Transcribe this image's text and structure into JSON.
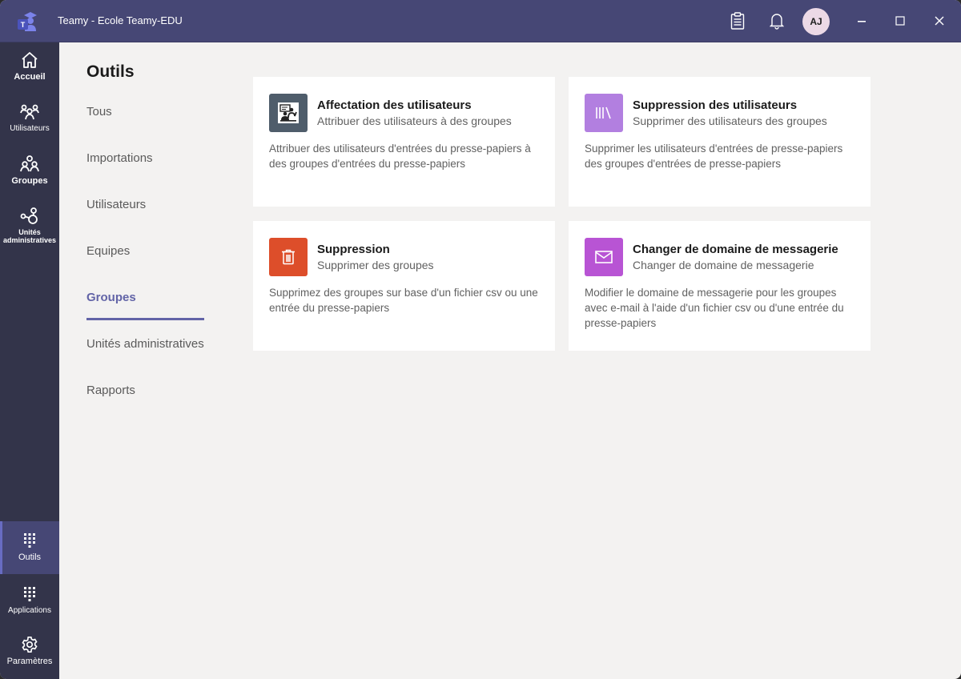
{
  "window": {
    "title": "Teamy - Ecole Teamy-EDU",
    "avatar_initials": "AJ",
    "icons": [
      "app-logo-icon",
      "clipboard-icon",
      "bell-icon",
      "minimize-icon",
      "maximize-icon",
      "close-icon"
    ]
  },
  "rail": {
    "items": [
      {
        "label": "Accueil",
        "icon": "home-icon"
      },
      {
        "label": "Utilisateurs",
        "icon": "users-icon"
      },
      {
        "label": "Groupes",
        "icon": "groups-icon"
      },
      {
        "label": "Unités administratives",
        "icon": "admin-units-icon"
      },
      {
        "label": "Outils",
        "icon": "grid-icon",
        "active": true
      },
      {
        "label": "Applications",
        "icon": "grid-icon"
      },
      {
        "label": "Paramètres",
        "icon": "gear-icon"
      }
    ]
  },
  "nav": {
    "title": "Outils",
    "items": [
      {
        "label": "Tous"
      },
      {
        "label": "Importations"
      },
      {
        "label": "Utilisateurs"
      },
      {
        "label": "Equipes"
      },
      {
        "label": "Groupes",
        "active": true
      },
      {
        "label": "Unités administratives"
      },
      {
        "label": "Rapports"
      }
    ]
  },
  "cards": [
    {
      "title": "Affectation des utilisateurs",
      "subtitle": "Attribuer des utilisateurs à des groupes",
      "description": "Attribuer des utilisateurs d'entrées du presse-papiers à des groupes d'entrées du presse-papiers",
      "icon": "assign-users-icon",
      "color": "#4f5d6b"
    },
    {
      "title": "Suppression des utilisateurs",
      "subtitle": "Supprimer des utilisateurs des groupes",
      "description": "Supprimer les utilisateurs d'entrées de presse-papiers des groupes d'entrées de presse-papiers",
      "icon": "library-icon",
      "color": "#b27fe0"
    },
    {
      "title": "Suppression",
      "subtitle": "Supprimer des groupes",
      "description": "Supprimez des groupes sur base d'un fichier csv ou une entrée du presse-papiers",
      "icon": "trash-icon",
      "color": "#dd4e2a"
    },
    {
      "title": "Changer de domaine de messagerie",
      "subtitle": "Changer de domaine de messagerie",
      "description": "Modifier le domaine de messagerie pour les groupes avec e-mail à l'aide d'un fichier csv ou d'une entrée du presse-papiers",
      "icon": "mail-icon",
      "color": "#b854d4"
    }
  ]
}
